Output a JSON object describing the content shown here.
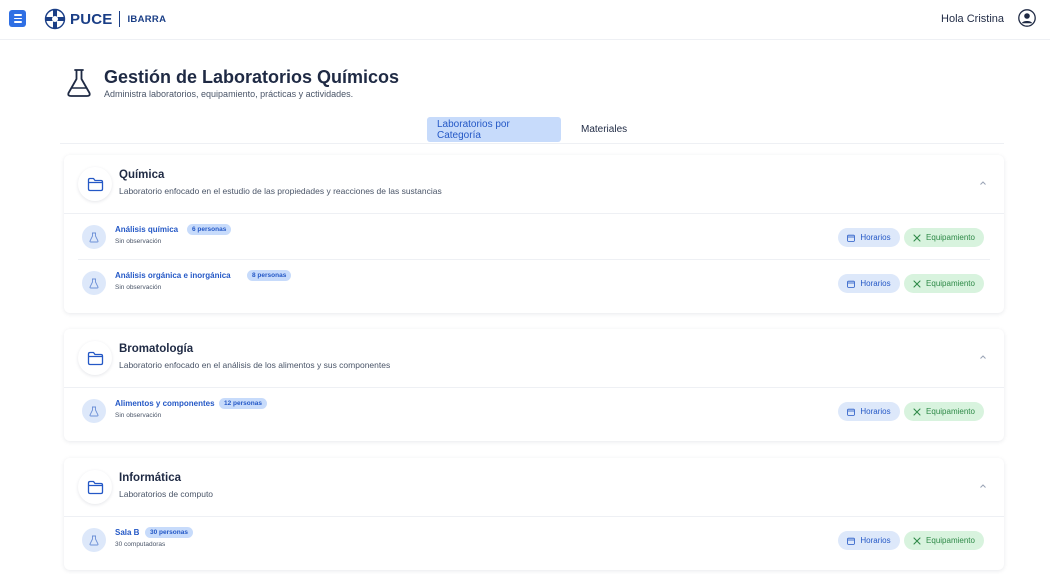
{
  "topbar": {
    "logo_text": "PUCE",
    "logo_sub": "IBARRA",
    "greeting": "Hola Cristina"
  },
  "header": {
    "title": "Gestión de Laboratorios Químicos",
    "subtitle": "Administra laboratorios, equipamiento, prácticas y actividades."
  },
  "tabs": [
    {
      "label": "Laboratorios por Categoría",
      "active": true
    },
    {
      "label": "Materiales",
      "active": false
    }
  ],
  "actions": {
    "horarios": "Horarios",
    "equipamiento": "Equipamiento"
  },
  "categories": [
    {
      "name": "Química",
      "description": "Laboratorio enfocado en el estudio de las propiedades y reacciones de las sustancias",
      "labs": [
        {
          "name": "Análisis química",
          "badge": "6 personas",
          "note": "Sin observación"
        },
        {
          "name": "Análisis orgánica e inorgánica",
          "badge": "8 personas",
          "note": "Sin observación"
        }
      ]
    },
    {
      "name": "Bromatología",
      "description": "Laboratorio enfocado en el análisis de los alimentos y sus componentes",
      "labs": [
        {
          "name": "Alimentos y componentes",
          "badge": "12 personas",
          "note": "Sin observación"
        }
      ]
    },
    {
      "name": "Informática",
      "description": "Laboratorios de computo",
      "labs": [
        {
          "name": "Sala B",
          "badge": "30 personas",
          "note": "30 computadoras"
        }
      ]
    }
  ],
  "colors": {
    "accent": "#2f6fe4",
    "brand": "#1a3e86",
    "tab_active_bg": "#c7dbfb",
    "equip_bg": "#d8f3de",
    "equip_text": "#2f8a48"
  },
  "icons": {
    "menu": "menu-icon",
    "user": "user-circle-icon",
    "flask": "flask-icon",
    "folder": "folder-icon",
    "chevron": "chevron-up-icon",
    "calendar": "calendar-icon",
    "tools": "tools-icon"
  }
}
